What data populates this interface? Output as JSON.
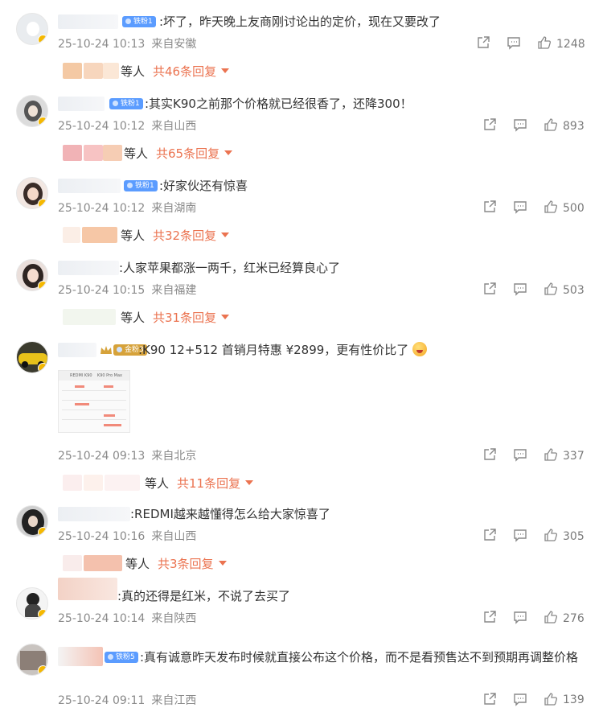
{
  "comments": [
    {
      "tag": "铁粉1",
      "text": ":坏了，昨天晚上友商刚讨论出的定价，现在又要改了",
      "time": "25-10-24 10:13",
      "location": "来自安徽",
      "likes": "1248",
      "reply": {
        "who": "等人",
        "count": "共46条回复"
      }
    },
    {
      "tag": "铁粉1",
      "text": ":其实K90之前那个价格就已经很香了，还降300！",
      "time": "25-10-24 10:12",
      "location": "来自山西",
      "likes": "893",
      "reply": {
        "who": "等人",
        "count": "共65条回复"
      }
    },
    {
      "tag": "铁粉1",
      "text": ":好家伙还有惊喜",
      "time": "25-10-24 10:12",
      "location": "来自湖南",
      "likes": "500",
      "reply": {
        "who": "等人",
        "count": "共32条回复"
      }
    },
    {
      "tag": "",
      "text": ":人家苹果都涨一两千，红米已经算良心了",
      "time": "25-10-24 10:15",
      "location": "来自福建",
      "likes": "503",
      "reply": {
        "who": "等人",
        "count": "共31条回复"
      }
    },
    {
      "tag": "金粉3",
      "text": ":K90 12+512 首销月特惠 ¥2899，更有性价比了",
      "time": "25-10-24 09:13",
      "location": "来自北京",
      "likes": "337",
      "reply": {
        "who": "等人",
        "count": "共11条回复"
      }
    },
    {
      "tag": "",
      "text": ":REDMI越来越懂得怎么给大家惊喜了",
      "time": "25-10-24 10:16",
      "location": "来自山西",
      "likes": "305",
      "reply": {
        "who": "等人",
        "count": "共3条回复"
      }
    },
    {
      "tag": "",
      "text": ":真的还得是红米，不说了去买了",
      "time": "25-10-24 10:14",
      "location": "来自陕西",
      "likes": "276",
      "reply": null
    },
    {
      "tag": "铁粉5",
      "text": ":真有诚意昨天发布时候就直接公布这个价格，而不是看预售达不到预期再调整价格",
      "time": "25-10-24 09:11",
      "location": "来自江西",
      "likes": "139",
      "reply": null
    }
  ],
  "thumbnail": {
    "col1": "REDMI K90",
    "col2": "K90 Pro Max"
  },
  "colors": {
    "accent": "#eb7350",
    "meta": "#8a8a8a",
    "fan_tag": "#5b9cff"
  },
  "icons": [
    "share-icon",
    "comment-icon",
    "like-icon",
    "chevron-down-icon"
  ]
}
